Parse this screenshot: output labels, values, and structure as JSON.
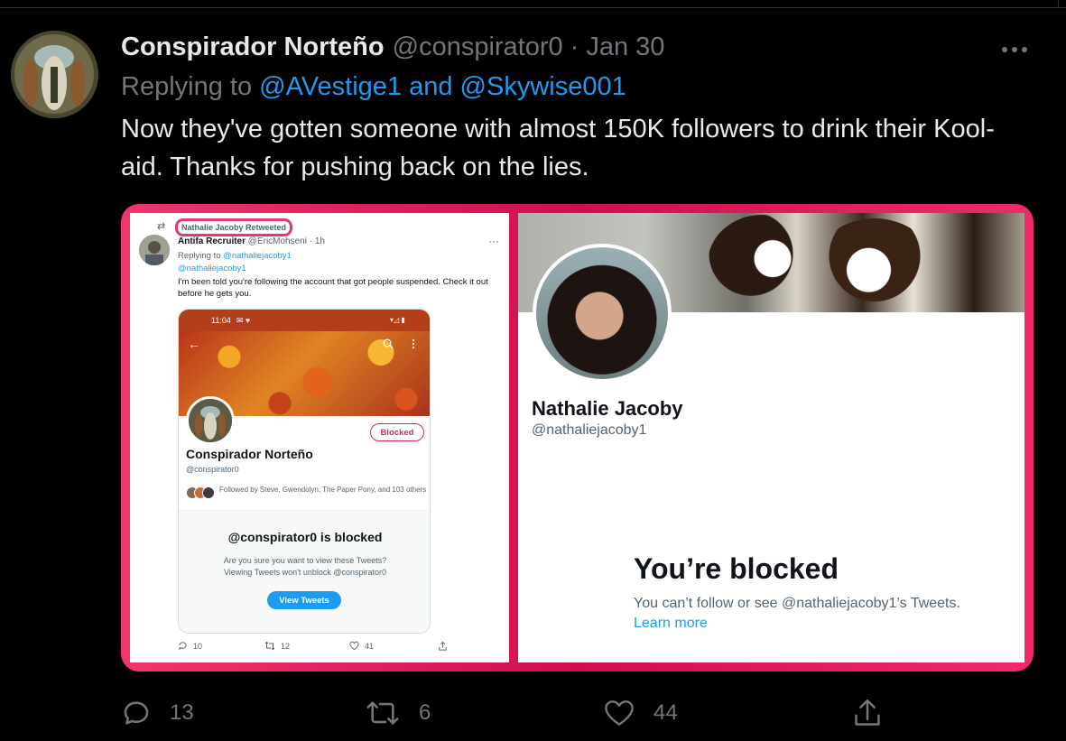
{
  "tweet": {
    "author_name": "Conspirador Norteño",
    "author_handle": "@conspirator0",
    "separator": "·",
    "date": "Jan 30",
    "replying_prefix": "Replying to",
    "replying_to": "@AVestige1 and @Skywise001",
    "text": "Now they've gotten someone with almost 150K followers to drink their Kool-aid. Thanks for pushing back on the lies.",
    "actions": {
      "reply_count": "13",
      "retweet_count": "6",
      "like_count": "44"
    }
  },
  "media_left": {
    "retweet_label": "Nathalie Jacoby Retweeted",
    "author_name": "Antifa Recruiter",
    "author_meta": "@EricMohseni · 1h",
    "more": "···",
    "replying_prefix": "Replying to",
    "replying_to": "@nathaliejacoby1",
    "replying_to_2": "@nathaliejacoby1",
    "text": "I'm been told you're following the account that got people suspended. Check it out before he gets you.",
    "phone": {
      "time": "11:04",
      "status_extras": "✉ ♥",
      "status_icons": "▾◿ ▮",
      "back": "←",
      "blocked_button": "Blocked",
      "profile_name": "Conspirador Norteño",
      "profile_handle": "@conspirator0",
      "followed_by": "Followed by Steve, Gwendolyn, The Paper Pony, and 103 others",
      "blocked_title": "@conspirator0 is blocked",
      "blocked_sub_1": "Are you sure you want to view these Tweets?",
      "blocked_sub_2": "Viewing Tweets won't unblock @conspirator0",
      "view_button": "View Tweets"
    },
    "actions": {
      "reply_count": "10",
      "retweet_count": "12",
      "like_count": "41"
    }
  },
  "media_right": {
    "profile_name": "Nathalie Jacoby",
    "profile_handle": "@nathaliejacoby1",
    "blocked_title": "You’re blocked",
    "blocked_sub": "You can’t follow or see @nathaliejacoby1’s Tweets.",
    "learn_more": "Learn more"
  },
  "colors": {
    "background": "#000000",
    "text_primary": "#e7e9ea",
    "text_secondary": "#71767b",
    "link": "#1d9bf0",
    "media_frame": "#e0245e"
  },
  "icons": {
    "more": "more-horizontal-icon",
    "reply": "reply-icon",
    "retweet": "retweet-icon",
    "like": "heart-icon",
    "share": "share-icon"
  }
}
